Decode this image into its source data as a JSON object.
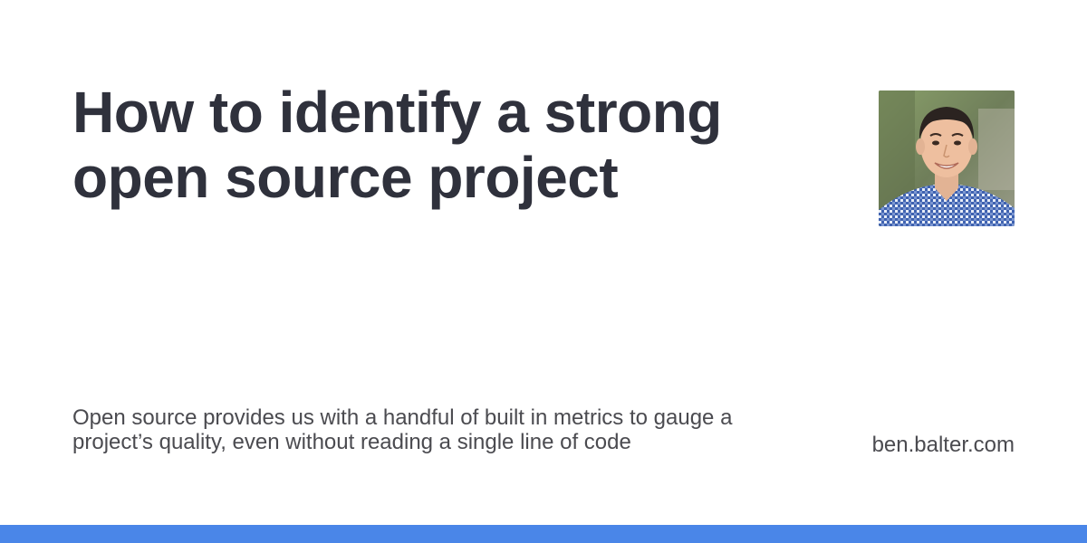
{
  "title": "How to identify a strong open source project",
  "description": "Open source provides us with a handful of built in metrics to gauge a project’s quality, even without reading a single line of code",
  "site": "ben.balter.com",
  "colors": {
    "title": "#2f313c",
    "text": "#4b4b50",
    "accent_bar": "#4a86e8",
    "background": "#ffffff"
  },
  "avatar": {
    "icon": "author-photo"
  }
}
